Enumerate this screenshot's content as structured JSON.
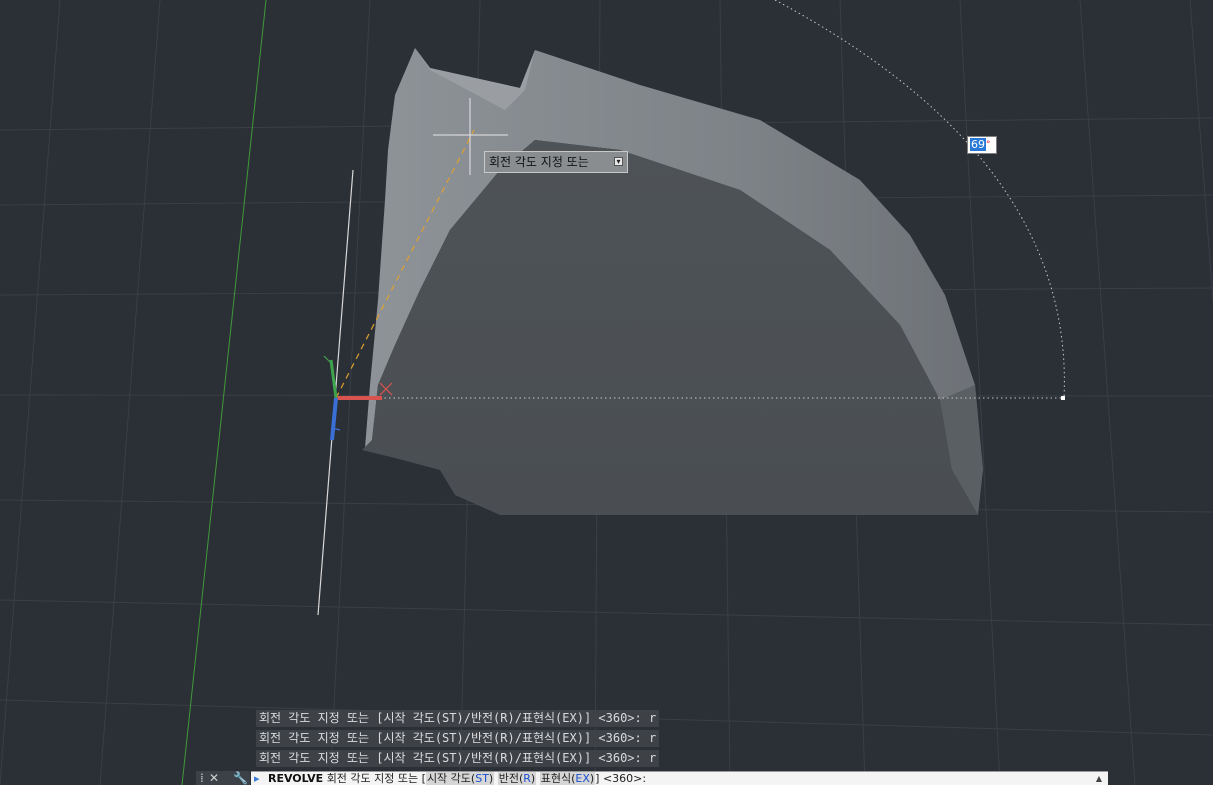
{
  "tooltip": {
    "text": "회전 각도 지정 또는",
    "icon": "expand-options-icon"
  },
  "angle_input": {
    "value": "69",
    "unit": "°"
  },
  "history": [
    "회전 각도 지정 또는 [시작 각도(ST)/반전(R)/표현식(EX)] <360>: r",
    "회전 각도 지정 또는 [시작 각도(ST)/반전(R)/표현식(EX)] <360>: r",
    "회전 각도 지정 또는 [시작 각도(ST)/반전(R)/표현식(EX)] <360>: r"
  ],
  "command_line": {
    "command": "REVOLVE",
    "prompt": "회전 각도 지정 또는 [",
    "options": [
      {
        "label": "시작 각도(",
        "key": "ST",
        "close": ")"
      },
      {
        "label": "반전(",
        "key": "R",
        "close": ")"
      },
      {
        "label": "표현식(",
        "key": "EX",
        "close": ")"
      }
    ],
    "suffix": "] <360>:"
  },
  "toolbar": {
    "grip_icon": "grip-icon",
    "close_label": "✕",
    "customize_icon": "wrench-icon"
  },
  "colors": {
    "background": "#2b2f36",
    "ucs_x": "#d9534f",
    "ucs_y": "#3fa34d",
    "ucs_z": "#3a6fd6",
    "rubber_band": "#e0a030"
  }
}
